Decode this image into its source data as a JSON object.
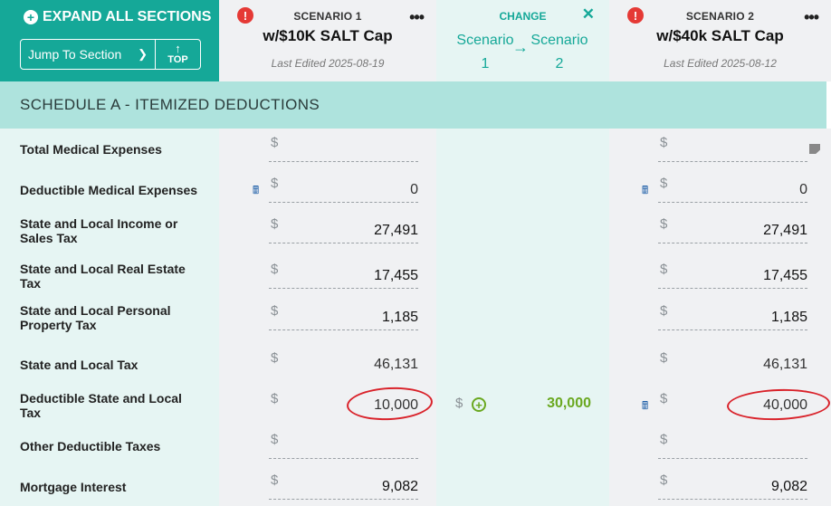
{
  "header": {
    "expand_all": "EXPAND ALL SECTIONS",
    "jump_to_section": "Jump To Section",
    "top_label": "TOP",
    "scenario1": {
      "label": "SCENARIO 1",
      "name": "w/$10K SALT Cap",
      "edited": "Last Edited 2025-08-19"
    },
    "change": {
      "label": "CHANGE",
      "from": "Scenario 1",
      "to": "Scenario 2"
    },
    "scenario2": {
      "label": "SCENARIO 2",
      "name": "w/$40k SALT Cap",
      "edited": "Last Edited 2025-08-12"
    }
  },
  "section": {
    "title": "SCHEDULE A - ITEMIZED DEDUCTIONS"
  },
  "currency_symbol": "$",
  "rows": [
    {
      "label": "Total Medical Expenses",
      "s1": "",
      "s2": "",
      "change": ""
    },
    {
      "label": "Deductible Medical Expenses",
      "s1": "0",
      "s2": "0",
      "change": ""
    },
    {
      "label": "State and Local Income or Sales Tax",
      "s1": "27,491",
      "s2": "27,491",
      "change": ""
    },
    {
      "label": "State and Local Real Estate Tax",
      "s1": "17,455",
      "s2": "17,455",
      "change": ""
    },
    {
      "label": "State and Local Personal Property Tax",
      "s1": "1,185",
      "s2": "1,185",
      "change": ""
    },
    {
      "label": "State and Local Tax",
      "s1": "46,131",
      "s2": "46,131",
      "change": ""
    },
    {
      "label": "Deductible State and Local Tax",
      "s1": "10,000",
      "s2": "40,000",
      "change": "30,000"
    },
    {
      "label": "Other Deductible Taxes",
      "s1": "",
      "s2": "",
      "change": ""
    },
    {
      "label": "Mortgage Interest",
      "s1": "9,082",
      "s2": "9,082",
      "change": ""
    }
  ],
  "colors": {
    "teal": "#15a898",
    "section_bg": "#aee3dd",
    "positive_change": "#6aa820",
    "annotation": "#d9222a"
  },
  "icons": [
    "plus-circle-icon",
    "chevron-down-icon",
    "arrow-up-icon",
    "alert-icon",
    "more-icon",
    "close-icon",
    "arrow-right-icon",
    "calculator-icon",
    "note-icon",
    "add-circle-icon"
  ]
}
